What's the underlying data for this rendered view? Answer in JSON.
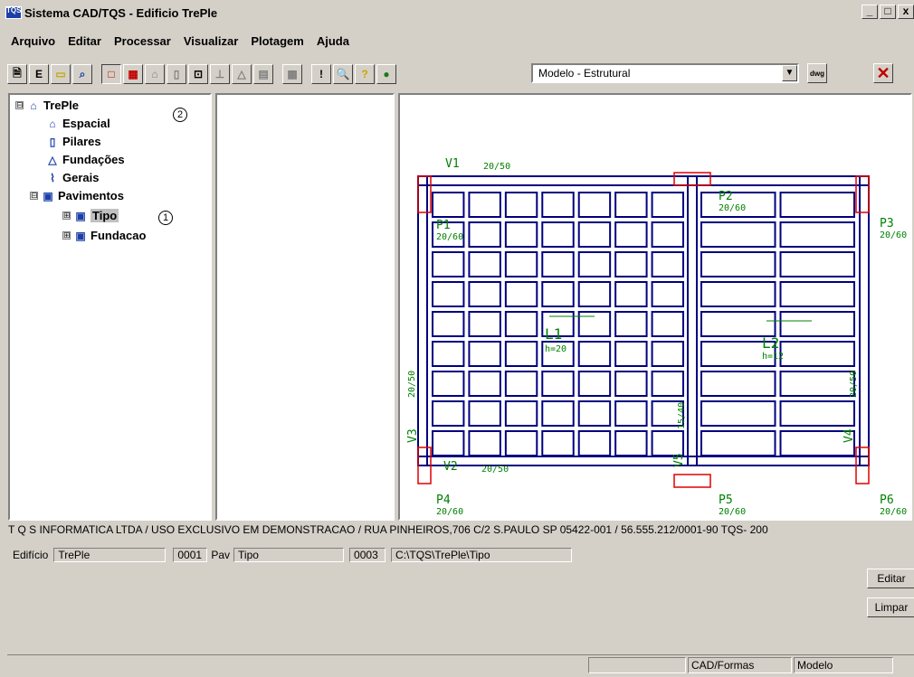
{
  "window": {
    "logo": "TQS",
    "title": "Sistema CAD/TQS - Edificio TrePle",
    "btn_min": "_",
    "btn_max": "□",
    "btn_close": "x"
  },
  "menu": [
    "Arquivo",
    "Editar",
    "Processar",
    "Visualizar",
    "Plotagem",
    "Ajuda"
  ],
  "toolbar": {
    "model_select": "Modelo - Estrutural",
    "dwg_label": "dwg"
  },
  "tree": {
    "root": "TrePle",
    "espacial": "Espacial",
    "pilares": "Pilares",
    "fundacoes": "Fundações",
    "gerais": "Gerais",
    "pavimentos": "Pavimentos",
    "tipo": "Tipo",
    "fundacao": "Fundacao",
    "expand": "⊞",
    "collapse": "⊟",
    "callout1": "1",
    "callout2": "2"
  },
  "drawing": {
    "v1": "V1",
    "v1_dim": "20/50",
    "v2": "V2",
    "v2_dim": "20/50",
    "v3": "V3",
    "v3_dim": "20/50",
    "v4": "V4",
    "v4_dim": "20/50",
    "v5": "V5",
    "v5_dim": "15/40",
    "p1": "P1",
    "p1_dim": "20/60",
    "p2": "P2",
    "p2_dim": "20/60",
    "p3": "P3",
    "p3_dim": "20/60",
    "p4": "P4",
    "p4_dim": "20/60",
    "p5": "P5",
    "p5_dim": "20/60",
    "p6": "P6",
    "p6_dim": "20/60",
    "l1": "L1",
    "l1_h": "h=20",
    "l2": "L2",
    "l2_h": "h=12"
  },
  "info_line": "T Q S  INFORMATICA LTDA / USO EXCLUSIVO EM DEMONSTRACAO / RUA PINHEIROS,706 C/2 S.PAULO SP 05422-001 / 56.555.212/0001-90 TQS- 200",
  "edificio": {
    "label": "Edifício",
    "value": "TrePle",
    "code": "0001",
    "pav_label": "Pav",
    "pav_value": "Tipo",
    "num": "0003",
    "path": "C:\\TQS\\TrePle\\Tipo"
  },
  "buttons": {
    "editar": "Editar",
    "limpar": "Limpar"
  },
  "status": {
    "mode": "CAD/Formas",
    "model": "Modelo"
  }
}
